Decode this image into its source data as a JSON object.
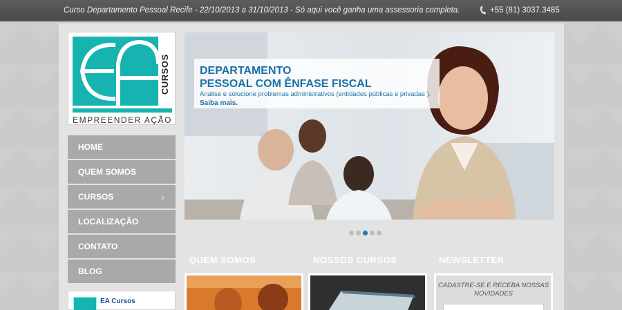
{
  "topbar": {
    "promo": "Curso Departamento Pessoal Recife - 22/10/2013 a 31/10/2013 - Só aqui você ganha uma assessoria completa.",
    "phone": "+55 (81) 3037.3485"
  },
  "logo": {
    "letters": "EA",
    "word": "CURSOS",
    "tagline": "EMPREENDER AÇÃO",
    "color": "#17b3b0"
  },
  "nav": {
    "items": [
      {
        "label": "HOME"
      },
      {
        "label": "QUEM SOMOS"
      },
      {
        "label": "CURSOS"
      },
      {
        "label": "LOCALIZAÇÃO"
      },
      {
        "label": "CONTATO"
      },
      {
        "label": "BLOG"
      }
    ]
  },
  "widget": {
    "name": "EA Cursos"
  },
  "slider": {
    "title_line1": "DEPARTAMENTO",
    "title_line2": "PESSOAL COM ÊNFASE FISCAL",
    "subtitle": "Analise e solucione problemas administrativos (entidades públicas e privadas ).",
    "link": "Saiba mais.",
    "slide_count": 5,
    "active_slide": 3
  },
  "sections": {
    "about": "QUEM SOMOS",
    "courses": "NOSSOS CURSOS",
    "newsletter": "NEWSLETTER"
  },
  "newsletter": {
    "prompt": "CADASTRE-SE E RECEBA NOSSAS NOVIDADES"
  },
  "colors": {
    "accent": "#17b3b0",
    "link_blue": "#1c6fa8",
    "nav_bg": "#a9a9a9",
    "header_tab": "#9e9e9e"
  }
}
